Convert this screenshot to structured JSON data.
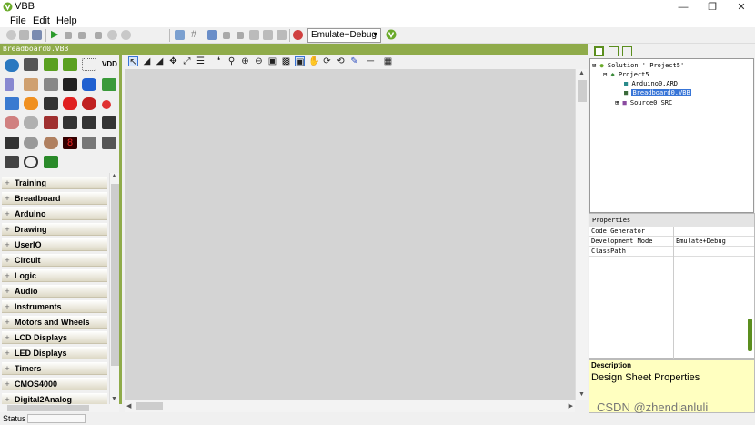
{
  "window": {
    "title": "VBB"
  },
  "menu": [
    "File",
    "Edit",
    "Help"
  ],
  "toolbar": {
    "mode": "Emulate+Debug"
  },
  "design_title": "Breadboard0.VBB",
  "palette_categories": [
    "Training",
    "Breadboard",
    "Arduino",
    "Drawing",
    "UserIO",
    "Circuit",
    "Logic",
    "Audio",
    "Instruments",
    "Motors and Wheels",
    "LCD Displays",
    "LED Displays",
    "Timers",
    "CMOS4000",
    "Digital2Analog"
  ],
  "tree": {
    "solution": "Solution ' Project5'",
    "project": "Project5",
    "items": [
      "Arduino0.ARD",
      "Breadboard0.VBB",
      "Source0.SRC"
    ]
  },
  "properties": {
    "header": "Properties",
    "rows": [
      {
        "key": "Code Generator",
        "value": ""
      },
      {
        "key": "Development Mode",
        "value": "Emulate+Debug"
      },
      {
        "key": "ClassPath",
        "value": ""
      }
    ]
  },
  "description": {
    "title": "Description",
    "text": "Design Sheet Properties"
  },
  "status": "Status",
  "watermark": "CSDN @zhendianluli",
  "colors": {
    "accent": "#8fab4a",
    "selection": "#3875d7",
    "canvas": "#d4d4d4"
  }
}
